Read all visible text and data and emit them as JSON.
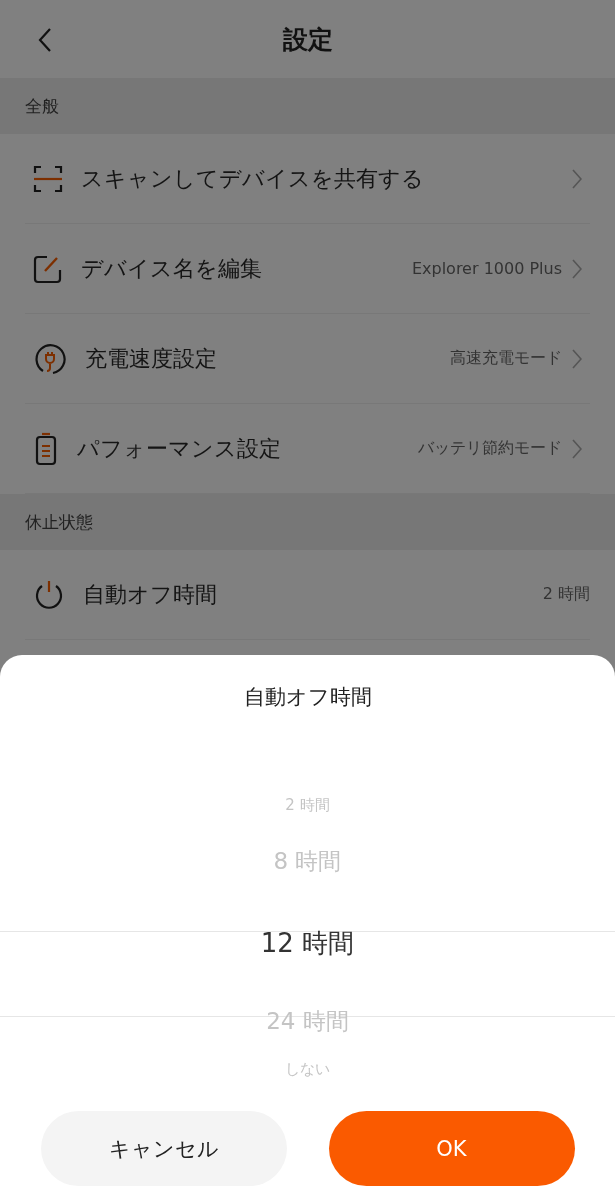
{
  "header": {
    "title": "設定"
  },
  "sections": [
    {
      "title": "全般",
      "rows": [
        {
          "label": "スキャンしてデバイスを共有する"
        },
        {
          "label": "デバイス名を編集",
          "value": "Explorer 1000 Plus"
        },
        {
          "label": "充電速度設定",
          "value": "高速充電モード"
        },
        {
          "label": "パフォーマンス設定",
          "value": "バッテリ節約モード"
        }
      ]
    },
    {
      "title": "休止状態",
      "rows": [
        {
          "label": "自動オフ時間",
          "value": "2 時間"
        }
      ]
    }
  ],
  "sheet": {
    "title": "自動オフ時間",
    "options": [
      {
        "label": "2 時間",
        "selected": false
      },
      {
        "label": "8 時間",
        "selected": false
      },
      {
        "label": "12 時間",
        "selected": true
      },
      {
        "label": "24 時間",
        "selected": false
      },
      {
        "label": "しない",
        "selected": false
      }
    ],
    "buttons": [
      {
        "label": "キャンセル",
        "kind": "secondary"
      },
      {
        "label": "OK",
        "kind": "primary"
      }
    ]
  }
}
